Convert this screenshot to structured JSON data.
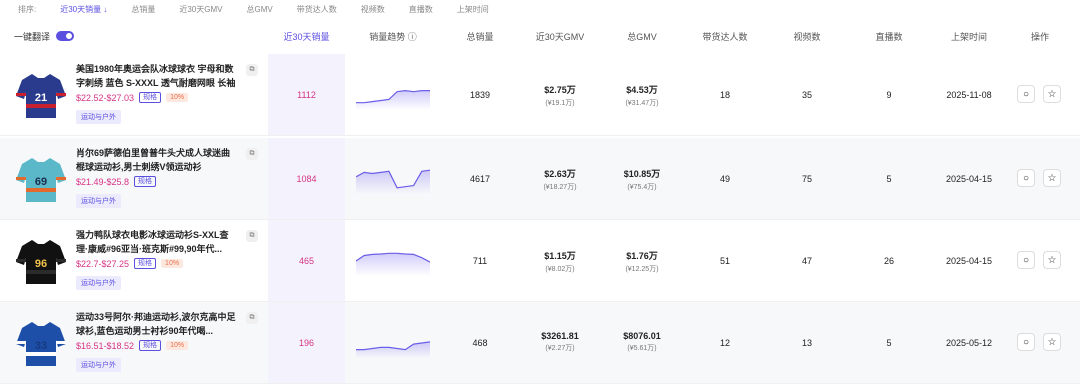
{
  "sortbar": {
    "label": "排序:",
    "items": [
      "近30天销量 ↓",
      "总销量",
      "近30天GMV",
      "总GMV",
      "带货达人数",
      "视频数",
      "直播数",
      "上架时间"
    ]
  },
  "header": {
    "translate_label": "一键翻译",
    "cols": [
      "近30天销量",
      "销量趋势 ⓘ",
      "总销量",
      "近30天GMV",
      "总GMV",
      "带货达人数",
      "视频数",
      "直播数",
      "上架时间",
      "操作"
    ]
  },
  "rows": [
    {
      "title": "美国1980年奥运会队冰球球衣 宇母和数字刺绣 蓝色 S-XXXL 透气耐磨网眼 长袖",
      "price": "$22.52-$27.03",
      "spec": "规格",
      "pct": "10%",
      "tag": "运动与户外",
      "sales30": "1112",
      "total": "1839",
      "gmv30": "$2.75万",
      "gmv30_sub": "(¥19.1万)",
      "gmv": "$4.53万",
      "gmv_sub": "(¥31.47万)",
      "creators": "18",
      "videos": "35",
      "lives": "9",
      "date": "2025-11-08",
      "trend": [
        0.15,
        0.15,
        0.2,
        0.25,
        0.3,
        0.65,
        0.7,
        0.65,
        0.7,
        0.7
      ]
    },
    {
      "title": "肖尔69萨德伯里曾普牛头犬成人球迷曲棍球运动衫,男士刺绣V领运动衫",
      "price": "$21.49-$25.8",
      "spec": "规格",
      "pct": "",
      "tag": "运动与户外",
      "sales30": "1084",
      "total": "4617",
      "gmv30": "$2.63万",
      "gmv30_sub": "(¥18.27万)",
      "gmv": "$10.85万",
      "gmv_sub": "(¥75.4万)",
      "creators": "49",
      "videos": "75",
      "lives": "5",
      "date": "2025-04-15",
      "trend": [
        0.6,
        0.8,
        0.75,
        0.8,
        0.85,
        0.1,
        0.15,
        0.2,
        0.85,
        0.9
      ]
    },
    {
      "title": "强力鸭队球衣电影冰球运动衫S-XXL查理·康威#96亚当·班克斯#99,90年代...",
      "price": "$22.7-$27.25",
      "spec": "规格",
      "pct": "10%",
      "tag": "运动与户外",
      "sales30": "465",
      "total": "711",
      "gmv30": "$1.15万",
      "gmv30_sub": "(¥8.02万)",
      "gmv": "$1.76万",
      "gmv_sub": "(¥12.25万)",
      "creators": "51",
      "videos": "47",
      "lives": "26",
      "date": "2025-04-15",
      "trend": [
        0.5,
        0.75,
        0.8,
        0.82,
        0.85,
        0.85,
        0.82,
        0.8,
        0.65,
        0.45
      ]
    },
    {
      "title": "运动33号阿尔·邦迪运动衫,波尔克高中足球衫,蓝色运动男士衬衫90年代喝...",
      "price": "$16.51-$18.52",
      "spec": "规格",
      "pct": "10%",
      "tag": "运动与户外",
      "sales30": "196",
      "total": "468",
      "gmv30": "$3261.81",
      "gmv30_sub": "(¥2.27万)",
      "gmv": "$8076.01",
      "gmv_sub": "(¥5.61万)",
      "creators": "12",
      "videos": "13",
      "lives": "5",
      "date": "2025-05-12",
      "trend": [
        0.2,
        0.2,
        0.25,
        0.3,
        0.3,
        0.25,
        0.2,
        0.45,
        0.5,
        0.55
      ]
    }
  ],
  "colors": {
    "accent": "#5b4fe0",
    "price": "#d63384"
  }
}
